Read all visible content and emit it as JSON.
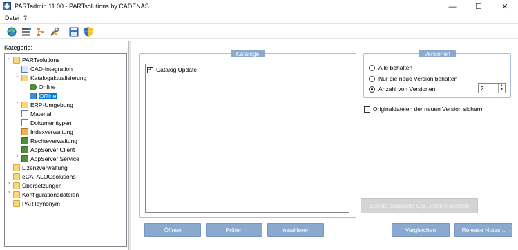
{
  "window": {
    "title": "PARTadmin 11.00 - PARTsolutions by CADENAS",
    "minimize_glyph": "—",
    "maximize_glyph": "☐",
    "close_glyph": "✕"
  },
  "menu": {
    "items": [
      {
        "label": "Datei"
      },
      {
        "label": "?"
      }
    ]
  },
  "toolbar": {
    "icons": [
      "sync-globe-icon",
      "catalog-stack-icon",
      "tree-structure-icon",
      "tools-icon",
      "save-icon",
      "shield-icon"
    ]
  },
  "sidebar": {
    "label": "Kategorie:",
    "tree": [
      {
        "label": "PARTsolutions",
        "expander": "⌄"
      },
      {
        "label": "CAD-Integration"
      },
      {
        "label": "Katalogaktualisierung",
        "expander": "⌄"
      },
      {
        "label": "Online"
      },
      {
        "label": "Offline"
      },
      {
        "label": "ERP-Umgebung",
        "expander": "›"
      },
      {
        "label": "Material"
      },
      {
        "label": "Dokumenttypen"
      },
      {
        "label": "Indexverwaltung"
      },
      {
        "label": "Rechteverwaltung"
      },
      {
        "label": "AppServer Client"
      },
      {
        "label": "AppServer Service",
        "expander": "›"
      },
      {
        "label": "Lizenzverwaltung"
      },
      {
        "label": "eCATALOGsolutions"
      },
      {
        "label": "Übersetzungen",
        "expander": "›"
      },
      {
        "label": "Konfigurationsdateien",
        "expander": "›"
      },
      {
        "label": "PARTsynonym"
      }
    ]
  },
  "kataloge": {
    "title": "Kataloge",
    "items": [
      {
        "label": "Catalog Update",
        "checked": true
      }
    ]
  },
  "versionen": {
    "title": "Versionen",
    "options": [
      {
        "label": "Alle behalten",
        "checked": false
      },
      {
        "label": "Nur die neue Version behalten",
        "checked": false
      },
      {
        "label": "Anzahl von Versionen",
        "checked": true
      }
    ],
    "count": "2",
    "spin_up": "▲",
    "spin_down": "▼"
  },
  "original_files": {
    "label": "Originaldateien der neuen Version sichern",
    "checked": false
  },
  "buttons": {
    "delete_cip": "Bereits entpackte Cip-Dateien löschen",
    "open": "Öffnen",
    "check": "Prüfen",
    "install": "Installieren",
    "compare": "Vergleichen",
    "release_notes": "Release Notes..."
  },
  "colors": {
    "accent": "#8aa9cf",
    "selection": "#0078d7",
    "disabled": "#d4d4d4"
  }
}
